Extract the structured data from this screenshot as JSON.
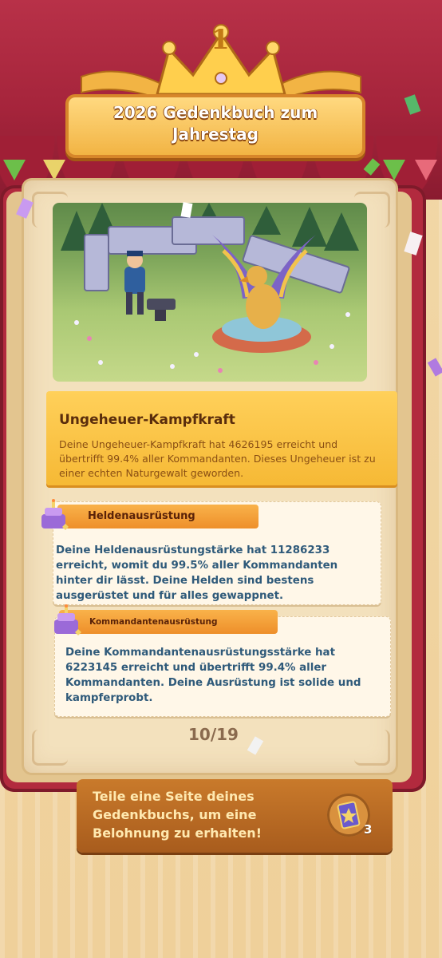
{
  "header": {
    "rank_number": "1",
    "title_line1": "2026 Gedenkbuch zum",
    "title_line2": "Jahrestag"
  },
  "feature": {
    "title": "Ungeheuer-Kampfkraft",
    "description": "Deine Ungeheuer-Kampfkraft hat 4626195 erreicht und übertrifft 99.4% aller Kommandanten. Dieses Ungeheuer ist zu einer echten Naturgewalt geworden."
  },
  "cards": [
    {
      "tag": "Heldenausrüstung",
      "text": "Deine Heldenausrüstungstärke hat 11286233 erreicht, womit du 99.5% aller Kommandanten hinter dir lässt. Deine Helden sind bestens ausgerüstet und für alles gewappnet."
    },
    {
      "tag": "Kommandantenausrüstung",
      "text": "Deine Kommandantenausrüstungsstärke hat 6223145 erreicht und übertrifft 99.4% aller Kommandanten. Deine Ausrüstung ist solide und kampferprobt."
    }
  ],
  "pager": "10/19",
  "reward": {
    "text": "Teile eine Seite deines Gedenkbuchs, um eine Belohnung zu erhalten!",
    "count": "3",
    "icon": "star-card-icon"
  },
  "colors": {
    "curtain": "#b83148",
    "banner": "#f6b935",
    "card_tag": "#ee8f2a",
    "card_text": "#2f5a7a"
  }
}
